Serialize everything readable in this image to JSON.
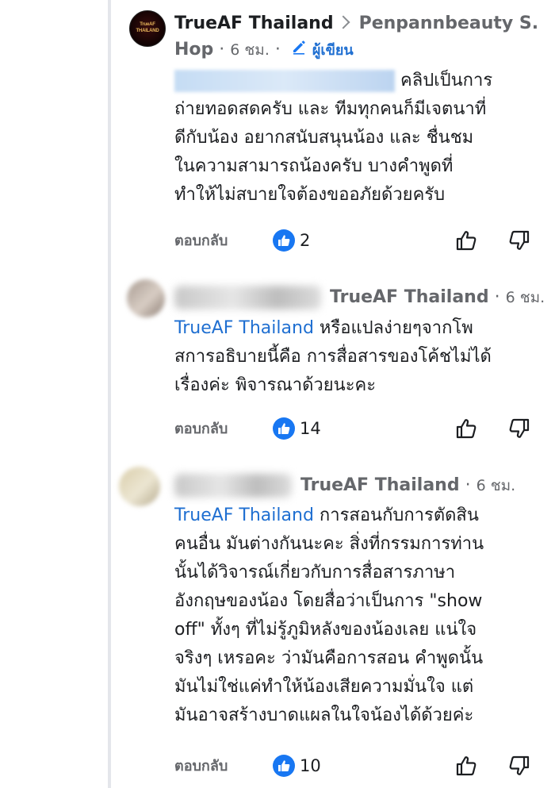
{
  "comment1": {
    "author": "TrueAF Thailand",
    "reply_to": "Penpannbeauty S. Hop",
    "reply_to_line1": "Penpannbeauty S.",
    "reply_to_line2": "Hop",
    "time": "6 ชม.",
    "author_badge": "ผู้เขียน",
    "text_line1": "คลิปเป็นการ",
    "text_line2": "ถ่ายทอดสดครับ และ ทีมทุกคนก็มีเจตนาที่",
    "text_line3": "ดีกับน้อง อยากสนับสนุนน้อง และ ชื่นชม",
    "text_line4": "ในความสามารถน้องครับ บางคำพูดที่",
    "text_line5": "ทำให้ไม่สบายใจต้องขออภัยด้วยครับ",
    "reply_label": "ตอบกลับ",
    "like_count": "2"
  },
  "comment2": {
    "reply_to": "TrueAF Thailand",
    "time": "6 ชม.",
    "mention": "TrueAF Thailand",
    "text_line1": "หรือแปลง่ายๆจากโพ",
    "text_line2": "สการอธิบายนี้คือ การสื่อสารของโค้ชไม่ได้",
    "text_line3": "เรื่องค่ะ พิจารณาด้วยนะคะ",
    "reply_label": "ตอบกลับ",
    "like_count": "14"
  },
  "comment3": {
    "reply_to": "TrueAF Thailand",
    "time": "6 ชม.",
    "mention": "TrueAF Thailand",
    "text_line1": "การสอนกับการตัดสิน",
    "text_line2": "คนอื่น มันต่างกันนะคะ สิ่งที่กรรมการท่าน",
    "text_line3": "นั้นได้วิจารณ์เกี่ยวกับการสื่อสารภาษา",
    "text_line4": "อังกฤษของน้อง โดยสื่อว่าเป็นการ \"show",
    "text_line5": "off\" ทั้งๆ ที่ไม่รู้ภูมิหลังของน้องเลย แน่ใจ",
    "text_line6": "จริงๆ เหรอคะ ว่ามันคือการสอน คำพูดนั้น",
    "text_line7": "มันไม่ใช่แค่ทำให้น้องเสียความมั่นใจ แต่",
    "text_line8": "มันอาจสร้างบาดแผลในใจน้องได้ด้วยค่ะ",
    "reply_label": "ตอบกลับ",
    "like_count": "10"
  },
  "colors": {
    "accent_blue": "#1877f2",
    "mention_blue": "#1f6fd1",
    "secondary_text": "#65676b"
  },
  "icons": [
    "like-reaction-icon",
    "thumbs-up-icon",
    "thumbs-down-icon",
    "pencil-icon",
    "chevron-right-icon"
  ]
}
